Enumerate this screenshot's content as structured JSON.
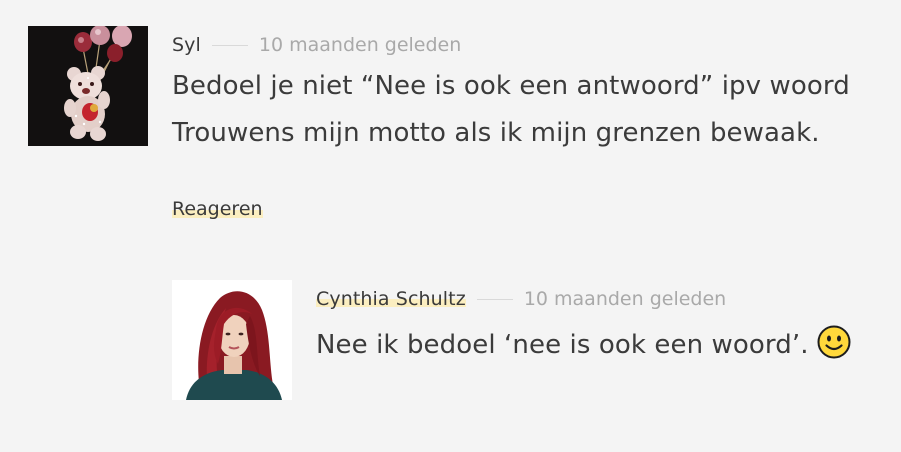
{
  "comments": [
    {
      "author": "Syl",
      "time": "10 maanden geleden",
      "lines": [
        "Bedoel je niet “Nee is ook een antwoord” ipv woord",
        "Trouwens mijn motto als ik mijn grenzen bewaak."
      ],
      "reply_label": "Reageren",
      "avatar_icon": "teddy-bear-balloons-avatar"
    }
  ],
  "reply": {
    "author": "Cynthia Schultz",
    "time": "10 maanden geleden",
    "line": "Nee ik bedoel ‘nee is ook een woord’.",
    "emoji_icon": "slightly-smiling-face-icon",
    "avatar_icon": "woman-red-hair-avatar"
  },
  "colors": {
    "background": "#f4f4f4",
    "text": "#3b3b3b",
    "muted": "#a9a9a9",
    "highlight": "#fbeec0"
  }
}
